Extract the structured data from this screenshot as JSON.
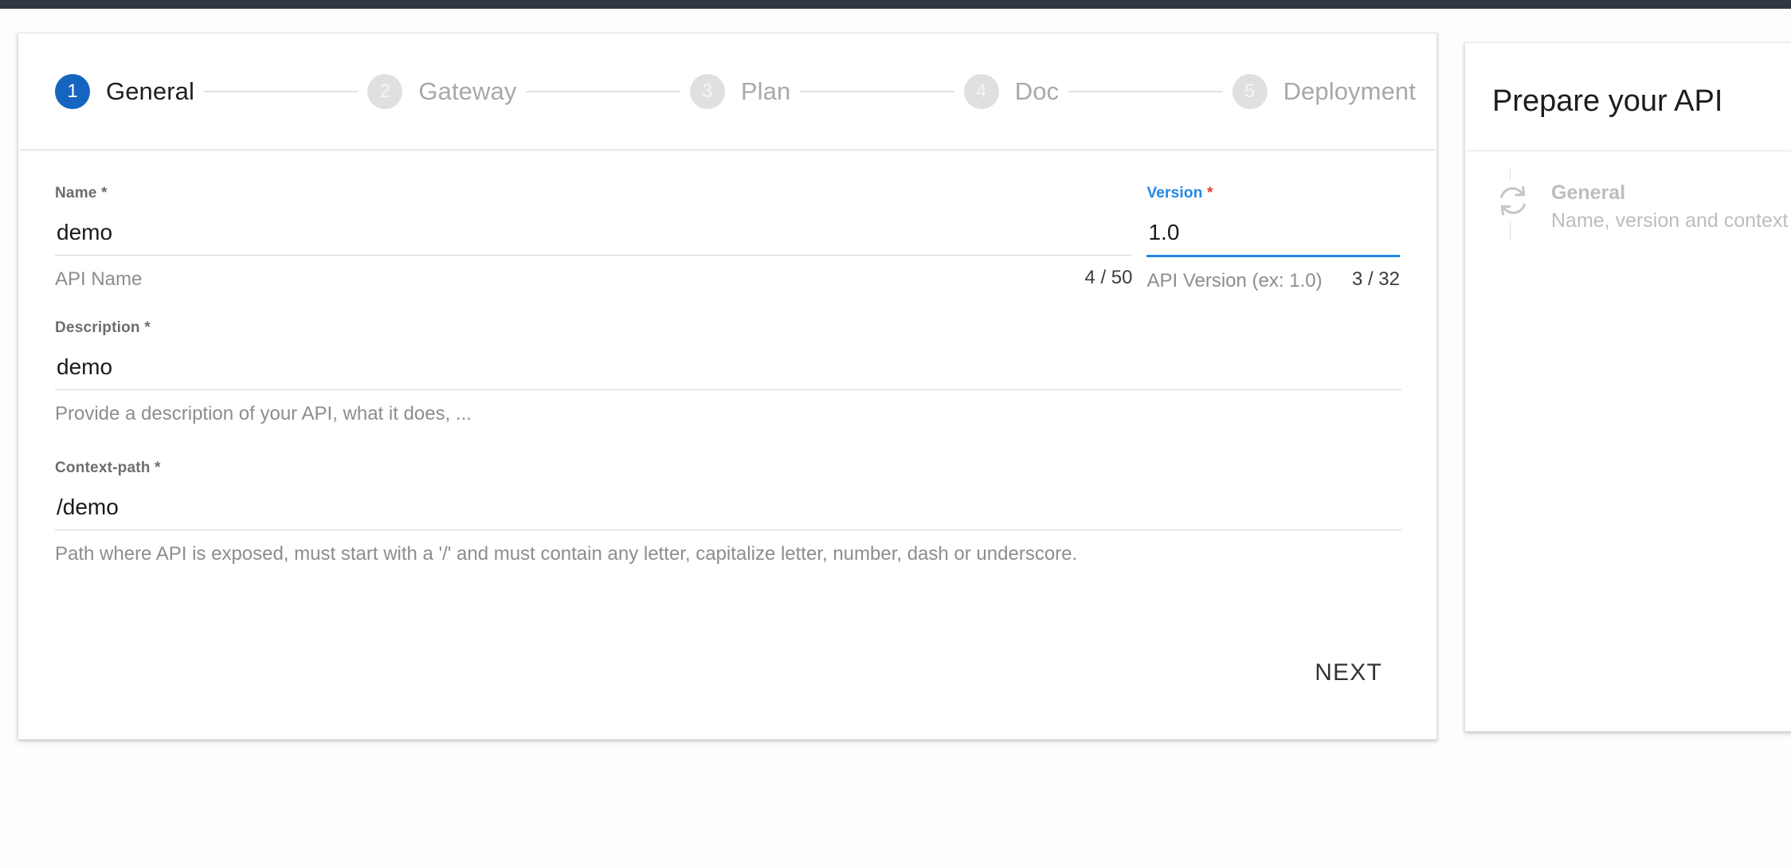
{
  "window": {
    "topbar_color": "#2f3741",
    "accent_color": "#1565c0",
    "focus_color": "#1e88e5",
    "required_color": "#e53935"
  },
  "stepper": {
    "steps": [
      {
        "number": "1",
        "label": "General",
        "state": "active"
      },
      {
        "number": "2",
        "label": "Gateway",
        "state": "inactive"
      },
      {
        "number": "3",
        "label": "Plan",
        "state": "inactive"
      },
      {
        "number": "4",
        "label": "Doc",
        "state": "inactive"
      },
      {
        "number": "5",
        "label": "Deployment",
        "state": "inactive"
      }
    ]
  },
  "form": {
    "name": {
      "label": "Name",
      "required_mark": "*",
      "value": "demo",
      "placeholder": "Name",
      "hint": "API Name",
      "counter": "4 / 50"
    },
    "version": {
      "label": "Version",
      "required_mark": "*",
      "value": "1.0",
      "placeholder": "Version",
      "hint": "API Version (ex: 1.0)",
      "counter": "3 / 32",
      "focused": true
    },
    "description": {
      "label": "Description",
      "required_mark": "*",
      "value": "demo",
      "placeholder": "Description",
      "hint": "Provide a description of your API, what it does, ..."
    },
    "context_path": {
      "label": "Context-path",
      "required_mark": "*",
      "value": "/demo",
      "placeholder": "Context-path",
      "hint": "Path where API is exposed, must start with a '/' and must contain any letter, capitalize letter, number, dash or underscore."
    },
    "next_label": "NEXT"
  },
  "side_panel": {
    "title": "Prepare your API",
    "items": [
      {
        "icon": "sync-icon",
        "title": "General",
        "subtitle": "Name, version and context"
      }
    ]
  }
}
